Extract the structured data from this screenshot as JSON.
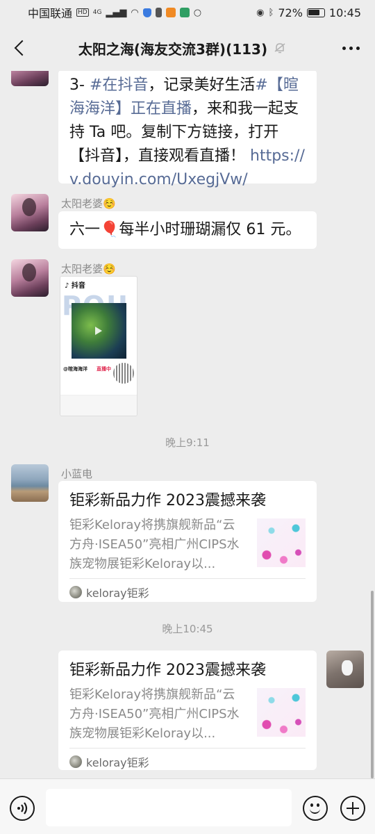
{
  "status_bar": {
    "carrier": "中国联通",
    "network_badges": [
      "HD",
      "4G"
    ],
    "battery": "72%",
    "time": "10:45"
  },
  "header": {
    "title": "太阳之海(海友交流3群)(113)"
  },
  "messages": [
    {
      "sender": "",
      "parts": [
        {
          "text": "3- ",
          "style": "normal"
        },
        {
          "text": "#在抖音",
          "style": "link"
        },
        {
          "text": "，记录美好生活",
          "style": "normal"
        },
        {
          "text": "#【暄海海洋】正在直播",
          "style": "link"
        },
        {
          "text": "，来和我一起支持 Ta 吧。复制下方链接，打开【抖音】，直接观看直播！ ",
          "style": "normal"
        },
        {
          "text": "https://v.douyin.com/UxegjVw/",
          "style": "url"
        }
      ]
    },
    {
      "sender": "太阳老婆☺️",
      "text": "六一🎈每半小时珊瑚漏仅 61 元。"
    },
    {
      "sender": "太阳老婆☺️",
      "image_card": {
        "app_logo": "抖音",
        "bg_text": "POU",
        "name": "@暄海海洋",
        "live": "直播中"
      }
    }
  ],
  "timestamps": [
    "晚上9:11",
    "晚上10:45"
  ],
  "article_1": {
    "sender": "小蓝电",
    "title": "钜彩新品力作 2023震撼来袭",
    "desc": "钜彩Keloray将携旗舰新品“云方舟·ISEA50”亮相广州CIPS水族宠物展钜彩Keloray以...",
    "source": "keloray钜彩"
  },
  "article_2": {
    "title": "钜彩新品力作 2023震撼来袭",
    "desc": "钜彩Keloray将携旗舰新品“云方舟·ISEA50”亮相广州CIPS水族宠物展钜彩Keloray以...",
    "source": "keloray钜彩"
  },
  "bottom_bar": {
    "input_placeholder": ""
  }
}
